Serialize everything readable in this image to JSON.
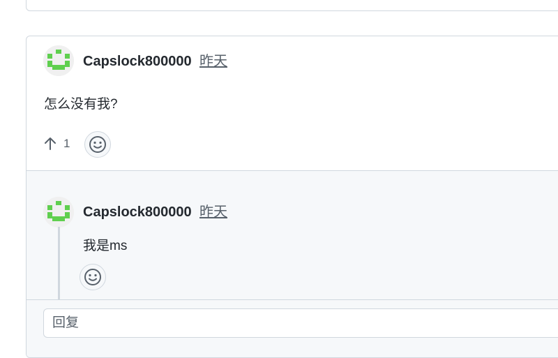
{
  "comment": {
    "author": "Capslock800000",
    "time": "昨天",
    "body": "怎么没有我?",
    "upvote_count": "1"
  },
  "reply": {
    "author": "Capslock800000",
    "time": "昨天",
    "body": "我是ms"
  },
  "reply_box": {
    "placeholder": "回复"
  },
  "colors": {
    "avatar_green": "#5fcf4f",
    "border": "#d0d7de",
    "muted": "#57606a",
    "reply_bg": "#f6f8fa"
  },
  "icons": {
    "upvote": "arrow-up-icon",
    "reaction": "smiley-icon"
  }
}
